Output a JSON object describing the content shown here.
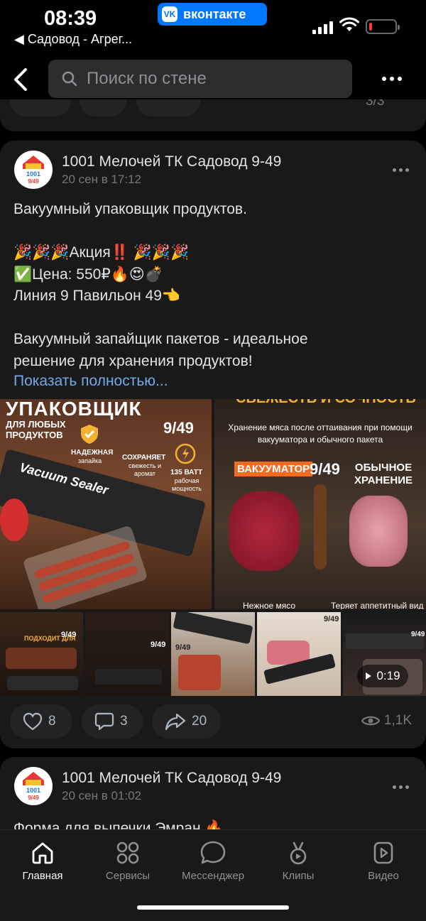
{
  "status_bar": {
    "time": "08:39",
    "app_badge": "вконтакте",
    "back_app": "◀ Садовод - Агрег..."
  },
  "header": {
    "search_placeholder": "Поиск по стене"
  },
  "previous_post": {
    "views": "3/3"
  },
  "post": {
    "author": "1001 Мелочей ТК Садовод 9-49",
    "date": "20 сен в 17:12",
    "avatar_text": "1001 Мелочь 9/49",
    "text": "Вакуумный упаковщик продуктов.\n\n🎉🎉🎉Акция‼️ 🎉🎉🎉\n✅Цена: 550₽🔥😍💣\nЛиния 9 Павильон 49👈\n\nВакуумный запайщик пакетов - идеальное\nрешение для хранения продуктов!",
    "show_more": "Показать полностью...",
    "images": {
      "img1_title": "УПАКОВЩИК",
      "img1_subtitle": "ДЛЯ ЛЮБЫХ ПРОДУКТОВ",
      "img1_badge": "9/49",
      "img1_feature1": "НАДЕЖНАЯ",
      "img1_feature1_sub": "запайка",
      "img1_feature2": "СОХРАНЯЕТ",
      "img1_feature2_sub": "свежесть и аромат",
      "img1_feature3": "135 ВАТТ",
      "img1_feature3_sub": "рабочая мощность",
      "img1_brand": "Vacuum Sealer",
      "img2_top": "СВЕЖЕСТЬ И СОЧНОСТЬ",
      "img2_caption": "Хранение мяса после оттаивания при помощи вакууматора и обычного пакета",
      "img2_left_label": "ВАКУУМАТОР",
      "img2_badge": "9/49",
      "img2_right_label": "ОБЫЧНОЕ ХРАНЕНИЕ",
      "img2_left_bottom": "Нежное мясо",
      "img2_right_bottom": "Теряет аппетитный вид",
      "thumb1_text": "ПОДХОДИТ ДЛЯ",
      "thumb_badge": "9/49",
      "video_duration": "0:19"
    },
    "likes": "8",
    "comments": "3",
    "reposts": "20",
    "views": "1,1K"
  },
  "next_post": {
    "author": "1001 Мелочей ТК Садовод 9-49",
    "date": "20 сен в 01:02",
    "text": "Форма для выпечки Эмран 🔥"
  },
  "tabbar": {
    "home": "Главная",
    "services": "Сервисы",
    "messenger": "Мессенджер",
    "clips": "Клипы",
    "video": "Видео"
  }
}
